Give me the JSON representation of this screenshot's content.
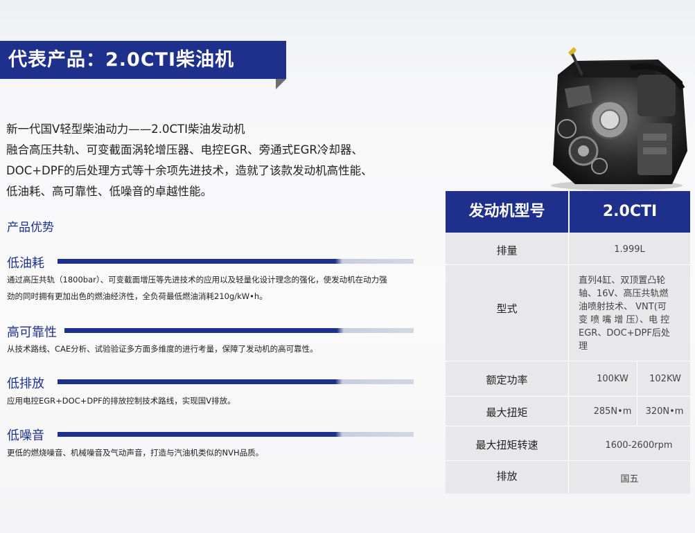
{
  "banner": {
    "title": "代表产品：2.0CTI柴油机"
  },
  "intro": {
    "lines": [
      "新一代国Ⅴ轻型柴油动力——2.0CTI柴油发动机",
      "融合高压共轨、可变截面涡轮增压器、电控EGR、旁通式EGR冷却器、",
      "DOC+DPF的后处理方式等十余项先进技术，造就了该款发动机高性能、",
      "低油耗、高可靠性、低噪音的卓越性能。"
    ]
  },
  "advantages": {
    "title": "产品优势",
    "items": [
      {
        "title": "低油耗",
        "desc_lines": [
          "通过高压共轨（1800bar）、可变截面增压等先进技术的应用以及轻量化设计理念的强化，使发动机在动力强",
          "劲的同时拥有更加出色的燃油经济性，全负荷最低燃油消耗210g/kW•h。"
        ]
      },
      {
        "title": "高可靠性",
        "desc_lines": [
          "从技术路线、CAE分析、试验验证多方面多维度的进行考量，保障了发动机的高可靠性。"
        ]
      },
      {
        "title": "低排放",
        "desc_lines": [
          "应用电控EGR+DOC+DPF的排放控制技术路线，实现国Ⅴ排放。"
        ]
      },
      {
        "title": "低噪音",
        "desc_lines": [
          "更低的燃烧噪音、机械噪音及气动声音，打造与汽油机类似的NVH品质。"
        ]
      }
    ]
  },
  "spec_table": {
    "header_label": "发动机型号",
    "header_value": "2.0CTI",
    "displacement": {
      "label": "排量",
      "value": "1.999L"
    },
    "type": {
      "label": "型式",
      "lines": [
        "直列4缸、双顶置凸轮",
        "轴、16V、高压共轨燃",
        "油喷射技术、 VNT(可",
        "变 喷 嘴 增 压）、电 控",
        "EGR、DOC+DPF后处",
        "理"
      ]
    },
    "power": {
      "label": "额定功率",
      "value1": "100KW",
      "value2": "102KW"
    },
    "torque": {
      "label": "最大扭矩",
      "value1": "285N•m",
      "value2": "320N•m"
    },
    "torque_speed": {
      "label": "最大扭矩转速",
      "value": "1600-2600rpm"
    },
    "emission": {
      "label": "排放",
      "value": "国五"
    }
  },
  "colors": {
    "brand_blue": "#1e2f8c",
    "bar_light": "#d4d7e2",
    "table_bg": "#e8e8ea"
  }
}
